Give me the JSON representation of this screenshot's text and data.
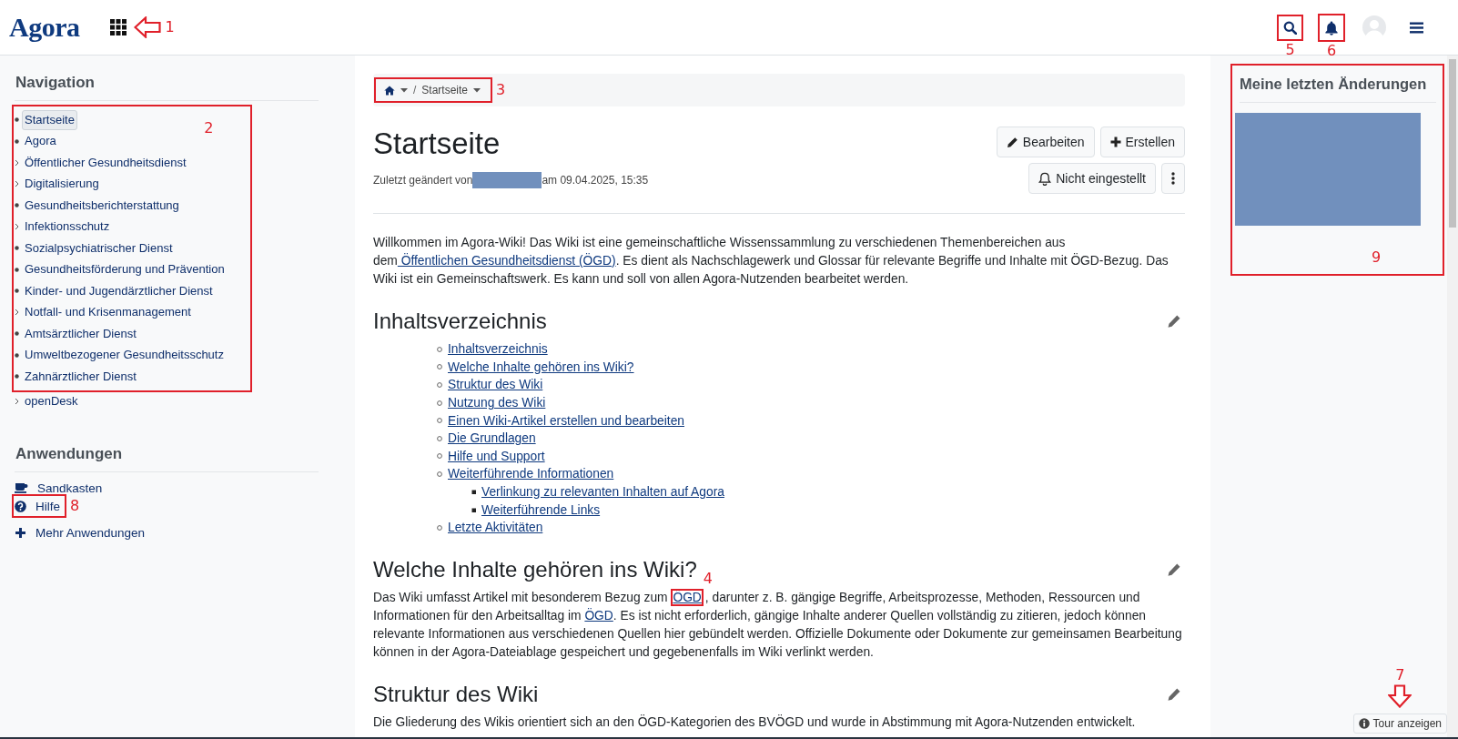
{
  "topbar": {
    "logo": "Agora",
    "apps_button": {
      "annotation": {
        "label": "1",
        "kind": "arrow-left"
      }
    },
    "search_button": {
      "annotation": {
        "label": "5",
        "kind": "box-below"
      }
    },
    "notifications_button": {
      "annotation": {
        "label": "6",
        "kind": "box-below"
      }
    }
  },
  "navigation": {
    "title": "Navigation",
    "groups": [
      {
        "annotation": {
          "label": "2",
          "kind": "box-inside-top"
        },
        "items": [
          {
            "label": "Startseite",
            "kind": "page",
            "selected": true
          },
          {
            "label": "Agora",
            "kind": "page",
            "selected": false
          },
          {
            "label": "Öffentlicher Gesundheitsdienst",
            "kind": "folder",
            "selected": false
          },
          {
            "label": "Digitalisierung",
            "kind": "folder",
            "selected": false
          },
          {
            "label": "Gesundheitsberichterstattung",
            "kind": "page",
            "selected": false
          },
          {
            "label": "Infektionsschutz",
            "kind": "folder",
            "selected": false
          },
          {
            "label": "Sozialpsychiatrischer Dienst",
            "kind": "page",
            "selected": false
          },
          {
            "label": "Gesundheitsförderung und Prävention",
            "kind": "page",
            "selected": false
          },
          {
            "label": "Kinder- und Jugendärztlicher Dienst",
            "kind": "page",
            "selected": false
          },
          {
            "label": "Notfall- und Krisenmanagement",
            "kind": "folder",
            "selected": false
          },
          {
            "label": "Amtsärztlicher Dienst",
            "kind": "page",
            "selected": false
          },
          {
            "label": "Umweltbezogener Gesundheitsschutz",
            "kind": "page",
            "selected": false
          },
          {
            "label": "Zahnärztlicher Dienst",
            "kind": "page",
            "selected": false
          }
        ]
      },
      {
        "items": [
          {
            "label": "openDesk",
            "kind": "folder",
            "selected": false
          }
        ]
      }
    ]
  },
  "applications": {
    "title": "Anwendungen",
    "items": [
      {
        "label": "Sandkasten",
        "kind": "cup"
      },
      {
        "label": "Hilfe",
        "kind": "help",
        "annotation": {
          "label": "8",
          "kind": "box-right"
        }
      },
      {
        "label": "Mehr Anwendungen",
        "kind": "add"
      }
    ]
  },
  "breadcrumb": {
    "annotation": {
      "label": "3",
      "kind": "box-right"
    },
    "separator": "/",
    "items": [
      {
        "kind": "home"
      },
      {
        "kind": "page",
        "label": "Startseite"
      }
    ]
  },
  "page": {
    "title": "Startseite",
    "meta": {
      "before": "Zuletzt geändert von",
      "author_redacted": true,
      "after": "am 09.04.2025, 15:35"
    },
    "buttons": [
      {
        "label": "Bearbeiten",
        "kind": "edit"
      },
      {
        "label": "Erstellen",
        "kind": "create"
      },
      {
        "label": "Nicht eingestellt",
        "kind": "subscribe"
      },
      {
        "kind": "more"
      }
    ],
    "intro": [
      {
        "text": "Willkommen im Agora-Wiki! Das Wiki ist eine gemeinschaftliche Wissenssammlung zu verschiedenen Themenbereichen aus dem"
      },
      {
        "link": " Öffentlichen Gesundheitsdienst (ÖGD)"
      },
      {
        "text": ". Es dient als Nachschlagewerk und Glossar für relevante Begriffe und Inhalte mit ÖGD-Bezug. Das Wiki ist ein Gemeinschaftswerk. Es kann und soll von allen Agora-Nutzenden bearbeitet werden."
      }
    ],
    "sections": [
      {
        "title": "Inhaltsverzeichnis",
        "toc": [
          {
            "label": "Inhaltsverzeichnis"
          },
          {
            "label": "Welche Inhalte gehören ins Wiki?"
          },
          {
            "label": "Struktur des Wiki"
          },
          {
            "label": "Nutzung des Wiki"
          },
          {
            "label": "Einen Wiki-Artikel erstellen und bearbeiten"
          },
          {
            "label": "Die Grundlagen"
          },
          {
            "label": "Hilfe und Support"
          },
          {
            "label": "Weiterführende Informationen",
            "children": [
              {
                "label": "Verlinkung zu relevanten Inhalten auf Agora"
              },
              {
                "label": "Weiterführende Links"
              }
            ]
          },
          {
            "label": "Letzte Aktivitäten"
          }
        ]
      },
      {
        "title": "Welche Inhalte gehören ins Wiki?",
        "paragraph": [
          {
            "text": "Das Wiki umfasst Artikel mit besonderem Bezug zum "
          },
          {
            "link": "ÖGD",
            "annotation": {
              "label": "4",
              "kind": "box-above"
            }
          },
          {
            "text": ", darunter z. B. gängige Begriffe, Arbeitsprozesse, Methoden, Ressourcen und Informationen für den Arbeitsalltag im "
          },
          {
            "link": "ÖGD"
          },
          {
            "text": ". Es ist nicht erforderlich, gängige Inhalte anderer Quellen vollständig zu zitieren, jedoch können relevante Informationen aus verschiedenen Quellen hier gebündelt werden. Offizielle Dokumente oder Dokumente zur gemeinsamen Bearbeitung können in der Agora-Dateiablage gespeichert und gegebenenfalls im Wiki verlinkt werden."
          }
        ]
      },
      {
        "title": "Struktur des Wiki",
        "paragraph": [
          {
            "text": "Die Gliederung des Wikis orientiert sich an den ÖGD-Kategorien des BVÖGD und wurde in Abstimmung mit Agora-Nutzenden entwickelt."
          }
        ]
      }
    ]
  },
  "recent_changes": {
    "title": "Meine letzten Änderungen",
    "content_redacted": true,
    "annotation": {
      "label": "9",
      "kind": "box-inside-bottom"
    }
  },
  "tour_button": {
    "label": "Tour anzeigen",
    "annotation": {
      "label": "7",
      "kind": "arrow-down"
    }
  }
}
